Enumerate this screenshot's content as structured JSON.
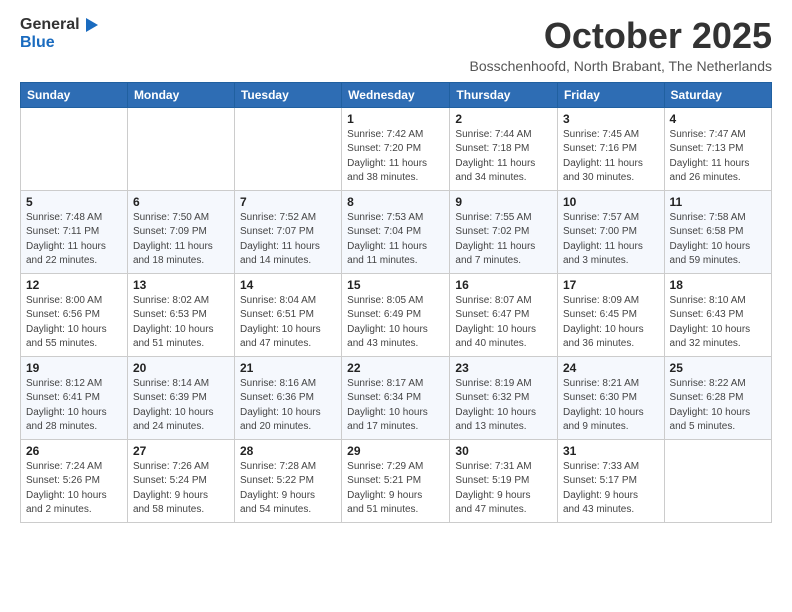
{
  "logo": {
    "general": "General",
    "blue": "Blue"
  },
  "header": {
    "month": "October 2025",
    "location": "Bosschenhoofd, North Brabant, The Netherlands"
  },
  "weekdays": [
    "Sunday",
    "Monday",
    "Tuesday",
    "Wednesday",
    "Thursday",
    "Friday",
    "Saturday"
  ],
  "weeks": [
    [
      {
        "day": "",
        "info": ""
      },
      {
        "day": "",
        "info": ""
      },
      {
        "day": "",
        "info": ""
      },
      {
        "day": "1",
        "info": "Sunrise: 7:42 AM\nSunset: 7:20 PM\nDaylight: 11 hours\nand 38 minutes."
      },
      {
        "day": "2",
        "info": "Sunrise: 7:44 AM\nSunset: 7:18 PM\nDaylight: 11 hours\nand 34 minutes."
      },
      {
        "day": "3",
        "info": "Sunrise: 7:45 AM\nSunset: 7:16 PM\nDaylight: 11 hours\nand 30 minutes."
      },
      {
        "day": "4",
        "info": "Sunrise: 7:47 AM\nSunset: 7:13 PM\nDaylight: 11 hours\nand 26 minutes."
      }
    ],
    [
      {
        "day": "5",
        "info": "Sunrise: 7:48 AM\nSunset: 7:11 PM\nDaylight: 11 hours\nand 22 minutes."
      },
      {
        "day": "6",
        "info": "Sunrise: 7:50 AM\nSunset: 7:09 PM\nDaylight: 11 hours\nand 18 minutes."
      },
      {
        "day": "7",
        "info": "Sunrise: 7:52 AM\nSunset: 7:07 PM\nDaylight: 11 hours\nand 14 minutes."
      },
      {
        "day": "8",
        "info": "Sunrise: 7:53 AM\nSunset: 7:04 PM\nDaylight: 11 hours\nand 11 minutes."
      },
      {
        "day": "9",
        "info": "Sunrise: 7:55 AM\nSunset: 7:02 PM\nDaylight: 11 hours\nand 7 minutes."
      },
      {
        "day": "10",
        "info": "Sunrise: 7:57 AM\nSunset: 7:00 PM\nDaylight: 11 hours\nand 3 minutes."
      },
      {
        "day": "11",
        "info": "Sunrise: 7:58 AM\nSunset: 6:58 PM\nDaylight: 10 hours\nand 59 minutes."
      }
    ],
    [
      {
        "day": "12",
        "info": "Sunrise: 8:00 AM\nSunset: 6:56 PM\nDaylight: 10 hours\nand 55 minutes."
      },
      {
        "day": "13",
        "info": "Sunrise: 8:02 AM\nSunset: 6:53 PM\nDaylight: 10 hours\nand 51 minutes."
      },
      {
        "day": "14",
        "info": "Sunrise: 8:04 AM\nSunset: 6:51 PM\nDaylight: 10 hours\nand 47 minutes."
      },
      {
        "day": "15",
        "info": "Sunrise: 8:05 AM\nSunset: 6:49 PM\nDaylight: 10 hours\nand 43 minutes."
      },
      {
        "day": "16",
        "info": "Sunrise: 8:07 AM\nSunset: 6:47 PM\nDaylight: 10 hours\nand 40 minutes."
      },
      {
        "day": "17",
        "info": "Sunrise: 8:09 AM\nSunset: 6:45 PM\nDaylight: 10 hours\nand 36 minutes."
      },
      {
        "day": "18",
        "info": "Sunrise: 8:10 AM\nSunset: 6:43 PM\nDaylight: 10 hours\nand 32 minutes."
      }
    ],
    [
      {
        "day": "19",
        "info": "Sunrise: 8:12 AM\nSunset: 6:41 PM\nDaylight: 10 hours\nand 28 minutes."
      },
      {
        "day": "20",
        "info": "Sunrise: 8:14 AM\nSunset: 6:39 PM\nDaylight: 10 hours\nand 24 minutes."
      },
      {
        "day": "21",
        "info": "Sunrise: 8:16 AM\nSunset: 6:36 PM\nDaylight: 10 hours\nand 20 minutes."
      },
      {
        "day": "22",
        "info": "Sunrise: 8:17 AM\nSunset: 6:34 PM\nDaylight: 10 hours\nand 17 minutes."
      },
      {
        "day": "23",
        "info": "Sunrise: 8:19 AM\nSunset: 6:32 PM\nDaylight: 10 hours\nand 13 minutes."
      },
      {
        "day": "24",
        "info": "Sunrise: 8:21 AM\nSunset: 6:30 PM\nDaylight: 10 hours\nand 9 minutes."
      },
      {
        "day": "25",
        "info": "Sunrise: 8:22 AM\nSunset: 6:28 PM\nDaylight: 10 hours\nand 5 minutes."
      }
    ],
    [
      {
        "day": "26",
        "info": "Sunrise: 7:24 AM\nSunset: 5:26 PM\nDaylight: 10 hours\nand 2 minutes."
      },
      {
        "day": "27",
        "info": "Sunrise: 7:26 AM\nSunset: 5:24 PM\nDaylight: 9 hours\nand 58 minutes."
      },
      {
        "day": "28",
        "info": "Sunrise: 7:28 AM\nSunset: 5:22 PM\nDaylight: 9 hours\nand 54 minutes."
      },
      {
        "day": "29",
        "info": "Sunrise: 7:29 AM\nSunset: 5:21 PM\nDaylight: 9 hours\nand 51 minutes."
      },
      {
        "day": "30",
        "info": "Sunrise: 7:31 AM\nSunset: 5:19 PM\nDaylight: 9 hours\nand 47 minutes."
      },
      {
        "day": "31",
        "info": "Sunrise: 7:33 AM\nSunset: 5:17 PM\nDaylight: 9 hours\nand 43 minutes."
      },
      {
        "day": "",
        "info": ""
      }
    ]
  ]
}
